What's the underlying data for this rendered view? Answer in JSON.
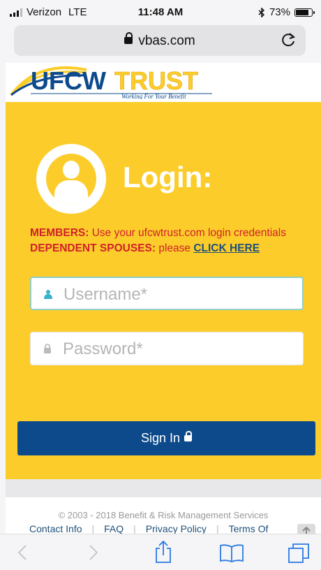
{
  "status_bar": {
    "carrier": "Verizon",
    "network": "LTE",
    "time": "11:48 AM",
    "battery": "73%",
    "battery_level": 0.73
  },
  "browser": {
    "url": "vbas.com"
  },
  "brand": {
    "logo_main": "UFCW",
    "logo_accent": "TRUST",
    "tagline": "Working For Your Benefit",
    "colors": {
      "navy": "#0d4a8b",
      "gold": "#fccd2a",
      "red": "#d0202a"
    }
  },
  "login": {
    "title": "Login:",
    "members_label": "MEMBERS:",
    "members_text": "Use your ufcwtrust.com login credentials",
    "spouses_label": "DEPENDENT SPOUSES:",
    "spouses_text": "please",
    "click_here": "CLICK HERE",
    "username_placeholder": "Username*",
    "password_placeholder": "Password*",
    "sign_in": "Sign In"
  },
  "footer": {
    "copyright": "© 2003 - 2018 Benefit & Risk Management Services",
    "links": [
      "Contact Info",
      "FAQ",
      "Privacy Policy",
      "Terms Of"
    ]
  },
  "toolbar": {
    "icons": [
      "back-icon",
      "forward-icon",
      "share-icon",
      "bookmarks-icon",
      "tabs-icon"
    ]
  }
}
